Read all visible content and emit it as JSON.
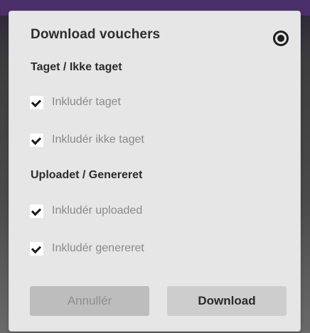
{
  "dialog": {
    "title": "Download vouchers",
    "close_icon": "close-circle-icon"
  },
  "sections": [
    {
      "heading": "Taget / Ikke taget",
      "options": [
        {
          "label": "Inkludér taget",
          "checked": true
        },
        {
          "label": "Inkludér ikke taget",
          "checked": true
        }
      ]
    },
    {
      "heading": "Uploadet / Genereret",
      "options": [
        {
          "label": "Inkludér uploaded",
          "checked": true
        },
        {
          "label": "Inkludér genereret",
          "checked": true
        }
      ]
    }
  ],
  "buttons": {
    "cancel_label": "Annullér",
    "download_label": "Download"
  },
  "colors": {
    "dialog_background": "#e6e6e6",
    "cancel_button": "#bdbdbd",
    "download_button": "#cdcdcd",
    "checkbox_tick": "#1a1a1a"
  }
}
